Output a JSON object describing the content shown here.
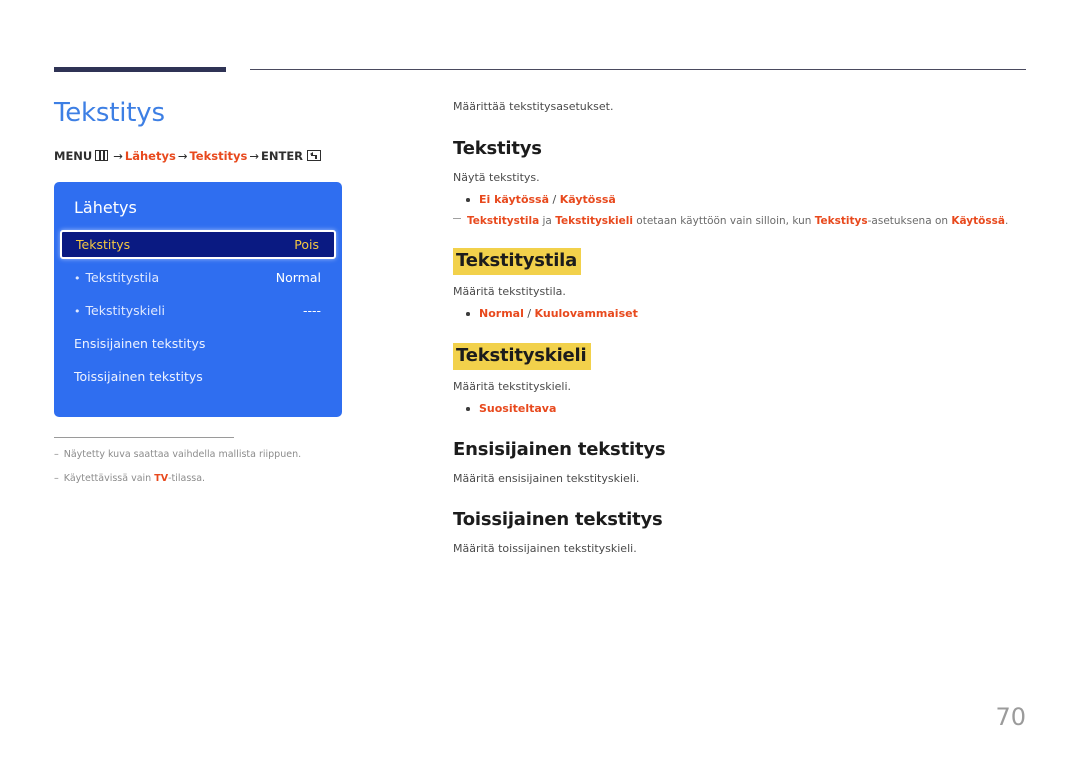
{
  "header": {
    "accent_bar_color": "#2f3355",
    "rule_color": "#4a4a5e"
  },
  "left": {
    "page_title": "Tekstitys",
    "menu_path": {
      "menu_label": "MENU",
      "menu_icon": "menu-grid-icon",
      "arrow": "→",
      "item1": "Lähetys",
      "item2": "Tekstitys",
      "enter_label": "ENTER",
      "enter_icon": "enter-key-icon"
    },
    "osd": {
      "title": "Lähetys",
      "rows": [
        {
          "label": "Tekstitys",
          "value": "Pois",
          "selected": true,
          "sub": false
        },
        {
          "label": "Tekstitystila",
          "value": "Normal",
          "selected": false,
          "sub": true
        },
        {
          "label": "Tekstityskieli",
          "value": "----",
          "selected": false,
          "sub": true
        },
        {
          "label": "Ensisijainen tekstitys",
          "value": "",
          "selected": false,
          "sub": false
        },
        {
          "label": "Toissijainen tekstitys",
          "value": "",
          "selected": false,
          "sub": false
        }
      ],
      "bullet": "•",
      "bg_color": "#2f6ef0",
      "selected_bg_color": "#0a1a82",
      "selected_text_color": "#f5c842"
    },
    "footnotes": [
      {
        "dash": "–",
        "pre": "Näytetty kuva saattaa vaihdella mallista riippuen.",
        "hl": "",
        "post": ""
      },
      {
        "dash": "–",
        "pre": "Käytettävissä vain ",
        "hl": "TV",
        "post": "-tilassa."
      }
    ]
  },
  "right": {
    "intro": "Määrittää tekstitysasetukset.",
    "sections": [
      {
        "heading": "Tekstitys",
        "highlighted": false,
        "body": "Näytä tekstitys.",
        "options": [
          {
            "a": "Ei käytössä",
            "sep": " / ",
            "b": "Käytössä"
          }
        ],
        "note": {
          "p1": "Tekstitystila",
          "p2": " ja ",
          "p3": "Tekstityskieli",
          "p4": " otetaan käyttöön vain silloin, kun ",
          "p5": "Tekstitys",
          "p6": "-asetuksena on ",
          "p7": "Käytössä",
          "p8": "."
        }
      },
      {
        "heading": "Tekstitystila",
        "highlighted": true,
        "body": "Määritä tekstitystila.",
        "options": [
          {
            "a": "Normal",
            "sep": " / ",
            "b": "Kuulovammaiset"
          }
        ],
        "note": null
      },
      {
        "heading": "Tekstityskieli",
        "highlighted": true,
        "body": "Määritä tekstityskieli.",
        "options": [
          {
            "a": "Suositeltava",
            "sep": "",
            "b": ""
          }
        ],
        "note": null
      },
      {
        "heading": "Ensisijainen tekstitys",
        "highlighted": false,
        "body": "Määritä ensisijainen tekstityskieli.",
        "options": [],
        "note": null
      },
      {
        "heading": "Toissijainen tekstitys",
        "highlighted": false,
        "body": "Määritä toissijainen tekstityskieli.",
        "options": [],
        "note": null
      }
    ]
  },
  "page_number": "70",
  "colors": {
    "accent_blue": "#3d7fe4",
    "accent_orange": "#e8491d",
    "highlight_yellow": "#f2d14b",
    "body_gray": "#4a4a4a"
  }
}
